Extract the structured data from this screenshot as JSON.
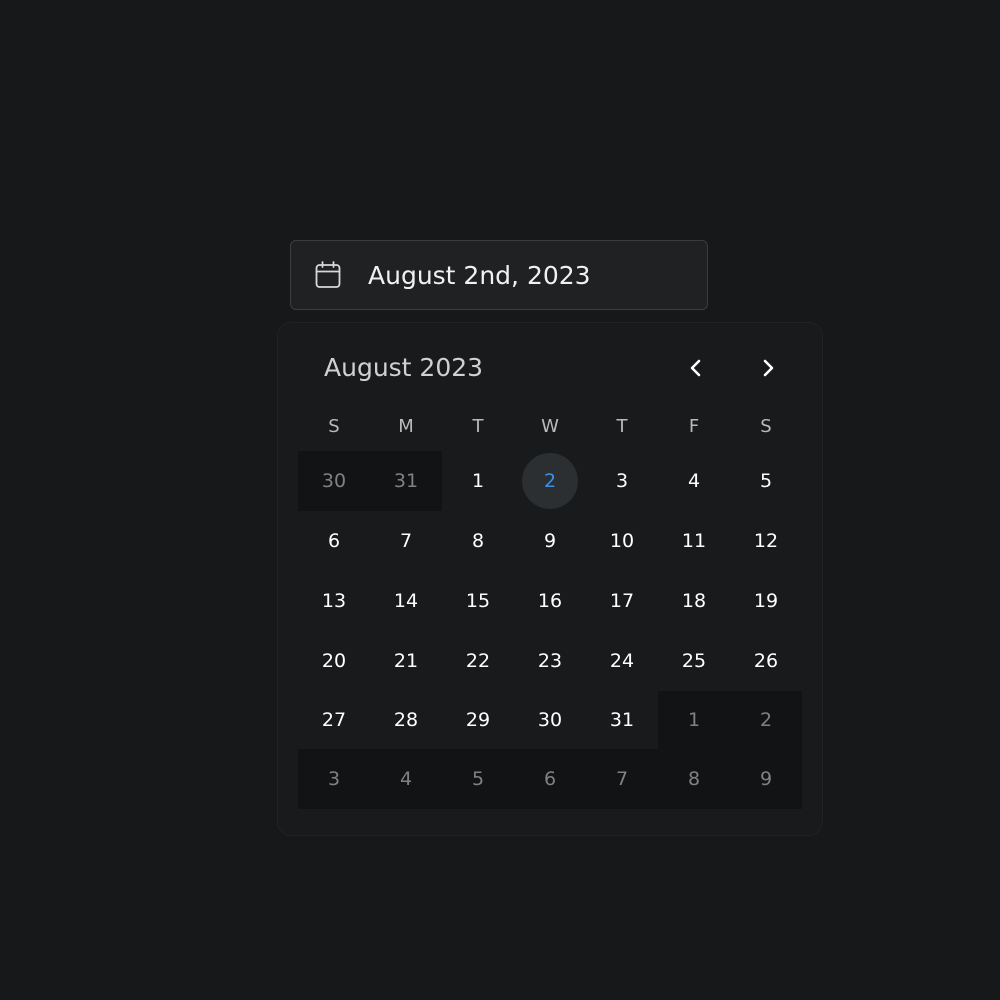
{
  "date_input": {
    "value": "August 2nd, 2023",
    "icon": "calendar-icon"
  },
  "calendar": {
    "month_label": "August 2023",
    "prev_icon": "chevron-left-icon",
    "next_icon": "chevron-right-icon",
    "weekdays": [
      "S",
      "M",
      "T",
      "W",
      "T",
      "F",
      "S"
    ],
    "days": [
      {
        "label": "30",
        "outside": true
      },
      {
        "label": "31",
        "outside": true
      },
      {
        "label": "1"
      },
      {
        "label": "2",
        "selected": true
      },
      {
        "label": "3"
      },
      {
        "label": "4"
      },
      {
        "label": "5"
      },
      {
        "label": "6"
      },
      {
        "label": "7"
      },
      {
        "label": "8"
      },
      {
        "label": "9"
      },
      {
        "label": "10"
      },
      {
        "label": "11"
      },
      {
        "label": "12"
      },
      {
        "label": "13"
      },
      {
        "label": "14"
      },
      {
        "label": "15"
      },
      {
        "label": "16"
      },
      {
        "label": "17"
      },
      {
        "label": "18"
      },
      {
        "label": "19"
      },
      {
        "label": "20"
      },
      {
        "label": "21"
      },
      {
        "label": "22"
      },
      {
        "label": "23"
      },
      {
        "label": "24"
      },
      {
        "label": "25"
      },
      {
        "label": "26"
      },
      {
        "label": "27"
      },
      {
        "label": "28"
      },
      {
        "label": "29"
      },
      {
        "label": "30"
      },
      {
        "label": "31"
      },
      {
        "label": "1",
        "outside": true
      },
      {
        "label": "2",
        "outside": true
      },
      {
        "label": "3",
        "outside": true
      },
      {
        "label": "4",
        "outside": true
      },
      {
        "label": "5",
        "outside": true
      },
      {
        "label": "6",
        "outside": true
      },
      {
        "label": "7",
        "outside": true
      },
      {
        "label": "8",
        "outside": true
      },
      {
        "label": "9",
        "outside": true
      }
    ],
    "colors": {
      "selected_text": "#3d8fe8",
      "selected_bg": "#2c2f32",
      "outside_text": "#7f8284"
    }
  }
}
